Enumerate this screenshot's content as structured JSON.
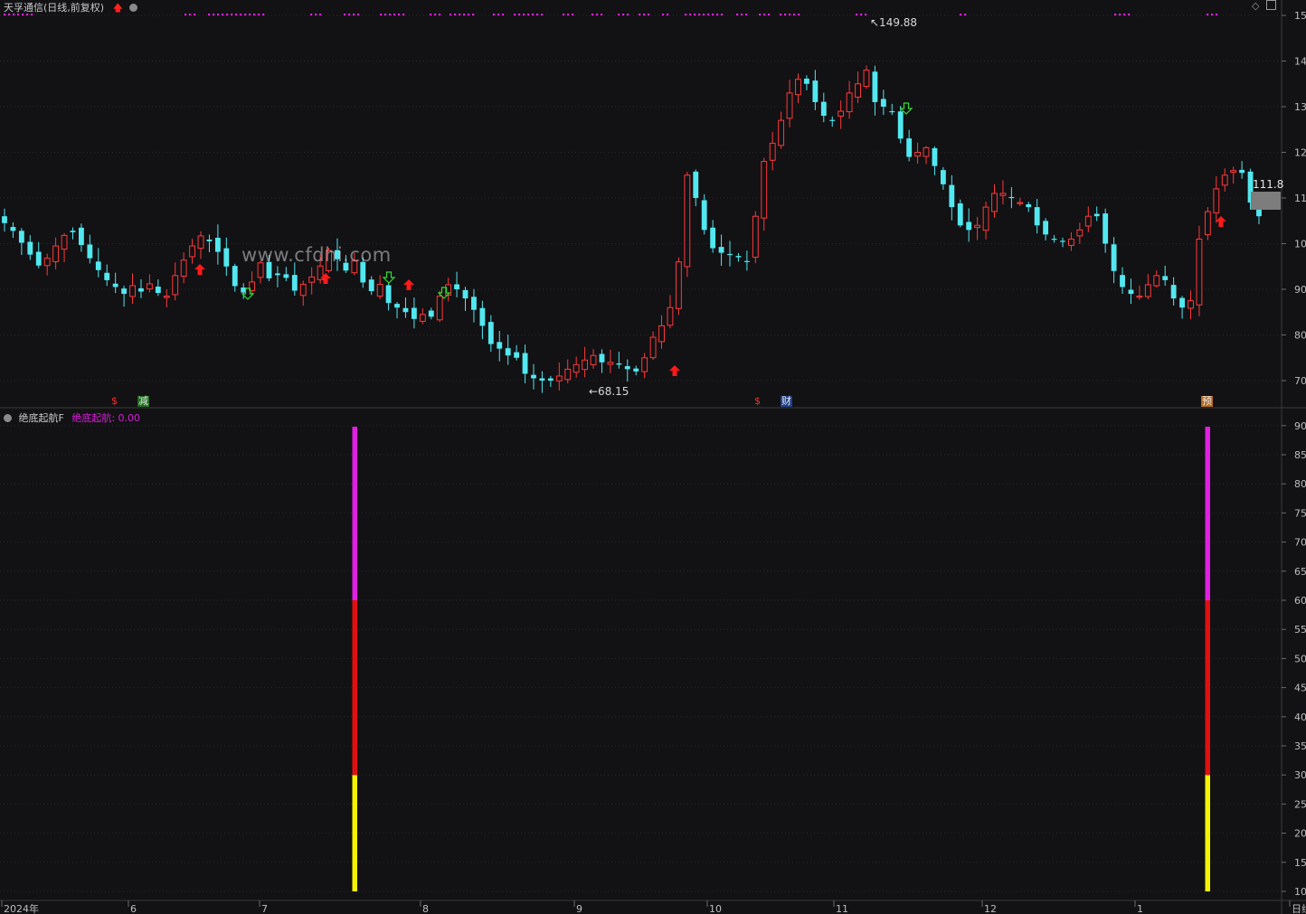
{
  "header": {
    "title": "天孚通信(日线,前复权)",
    "indicator_name": "绝底起航F",
    "indicator_value": "绝底起航: 0.00"
  },
  "watermark": "www.cfdhi.com",
  "price_axis": {
    "labels": [
      "15",
      "14",
      "13",
      "12",
      "11",
      "10",
      "90",
      "80",
      "70"
    ],
    "last_price_label": "111.8"
  },
  "indicator_axis": {
    "labels": [
      "90",
      "85",
      "80",
      "75",
      "70",
      "65",
      "60",
      "55",
      "50",
      "45",
      "40",
      "35",
      "30",
      "25",
      "20",
      "15",
      "10"
    ]
  },
  "time_axis": {
    "labels": [
      "2024年",
      "6",
      "7",
      "8",
      "9",
      "10",
      "11",
      "12",
      "1",
      "日线"
    ]
  },
  "annotations": {
    "high": "149.88",
    "low": "68.15"
  },
  "tags": [
    "$",
    "减",
    "$",
    "财",
    "预"
  ],
  "colors": {
    "background": "#121114",
    "up_candle": "#ff3a3a",
    "down_candle": "#52e8f0",
    "signal_magenta": "#e020e0",
    "signal_red": "#e01010",
    "signal_yellow": "#f4f400"
  },
  "chart_data": {
    "type": "candlestick",
    "series": [
      {
        "values": [
          104.5,
          102.8,
          100.2,
          97.6,
          95.2,
          96.8,
          99.5,
          101.8,
          102.5,
          99.7,
          96.8,
          94.2,
          92.0,
          90.5,
          89.0,
          90.8,
          89.5,
          91.2,
          89.2,
          88.5,
          93.0,
          96.4,
          99.5,
          101.7,
          100.5,
          98.2,
          95.0,
          90.7,
          89.3,
          91.6,
          95.8,
          92.4,
          93.1,
          92.5,
          89.7,
          91.1,
          92.7,
          95.1,
          98.5,
          96.6,
          94.1,
          96.3,
          91.5,
          89.6,
          91.1,
          87.0,
          86.0,
          85.0,
          83.5,
          84.5,
          84.0,
          88.5,
          91.0,
          90.0,
          88.0,
          85.5,
          82.0,
          78.0,
          77.0,
          75.5,
          75.0,
          71.5,
          70.5,
          70.0,
          70.0,
          71.0,
          72.5,
          73.5,
          74.5,
          75.5,
          74.0,
          74.0,
          73.5,
          72.5,
          72.0,
          75.0,
          79.5,
          82.0,
          86.0,
          96.0,
          115.0,
          110.0,
          103.0,
          99.0,
          98.0,
          97.5,
          97.0,
          96.0,
          106.0,
          118.0,
          122.0,
          127.0,
          133.0,
          136.0,
          135.0,
          131.0,
          128.0,
          127.0,
          129.0,
          133.0,
          135.0,
          138.0,
          131.0,
          130.0,
          129.0,
          123.0,
          119.0,
          120.0,
          121.0,
          117.0,
          113.0,
          108.0,
          104.0,
          103.0,
          104.0,
          108.0,
          111.0,
          111.0,
          110.0,
          109.0,
          108.0,
          104.0,
          102.0,
          101.0,
          100.5,
          101.0,
          103.0,
          106.0,
          106.0,
          100.0,
          94.0,
          90.5,
          89.0,
          88.5,
          91.0,
          93.0,
          92.0,
          88.0,
          86.0,
          87.5,
          101.0,
          107.0,
          112.0,
          115.0,
          116.0,
          115.5,
          109.0,
          106.0
        ],
        "ylim": [
          65,
          155
        ],
        "high": 149.88,
        "low": 68.15,
        "last": 111.8
      }
    ],
    "indicator": {
      "name": "绝底起航",
      "ylim": [
        10,
        90
      ],
      "signals": [
        {
          "segments": [
            {
              "from": 10,
              "to": 30,
              "color": "yellow"
            },
            {
              "from": 30,
              "to": 60,
              "color": "red"
            },
            {
              "from": 60,
              "to": 90,
              "color": "magenta"
            }
          ]
        },
        {
          "segments": [
            {
              "from": 10,
              "to": 30,
              "color": "yellow"
            },
            {
              "from": 30,
              "to": 60,
              "color": "red"
            },
            {
              "from": 60,
              "to": 90,
              "color": "magenta"
            }
          ]
        }
      ]
    }
  }
}
